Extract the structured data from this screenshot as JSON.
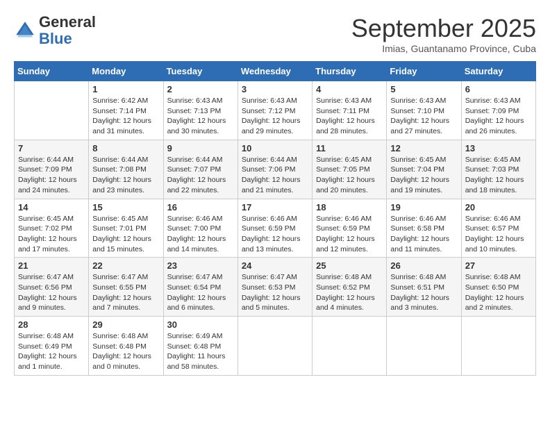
{
  "logo": {
    "general": "General",
    "blue": "Blue"
  },
  "header": {
    "month": "September 2025",
    "location": "Imias, Guantanamo Province, Cuba"
  },
  "days_of_week": [
    "Sunday",
    "Monday",
    "Tuesday",
    "Wednesday",
    "Thursday",
    "Friday",
    "Saturday"
  ],
  "weeks": [
    [
      {
        "day": "",
        "info": ""
      },
      {
        "day": "1",
        "info": "Sunrise: 6:42 AM\nSunset: 7:14 PM\nDaylight: 12 hours\nand 31 minutes."
      },
      {
        "day": "2",
        "info": "Sunrise: 6:43 AM\nSunset: 7:13 PM\nDaylight: 12 hours\nand 30 minutes."
      },
      {
        "day": "3",
        "info": "Sunrise: 6:43 AM\nSunset: 7:12 PM\nDaylight: 12 hours\nand 29 minutes."
      },
      {
        "day": "4",
        "info": "Sunrise: 6:43 AM\nSunset: 7:11 PM\nDaylight: 12 hours\nand 28 minutes."
      },
      {
        "day": "5",
        "info": "Sunrise: 6:43 AM\nSunset: 7:10 PM\nDaylight: 12 hours\nand 27 minutes."
      },
      {
        "day": "6",
        "info": "Sunrise: 6:43 AM\nSunset: 7:09 PM\nDaylight: 12 hours\nand 26 minutes."
      }
    ],
    [
      {
        "day": "7",
        "info": "Sunrise: 6:44 AM\nSunset: 7:09 PM\nDaylight: 12 hours\nand 24 minutes."
      },
      {
        "day": "8",
        "info": "Sunrise: 6:44 AM\nSunset: 7:08 PM\nDaylight: 12 hours\nand 23 minutes."
      },
      {
        "day": "9",
        "info": "Sunrise: 6:44 AM\nSunset: 7:07 PM\nDaylight: 12 hours\nand 22 minutes."
      },
      {
        "day": "10",
        "info": "Sunrise: 6:44 AM\nSunset: 7:06 PM\nDaylight: 12 hours\nand 21 minutes."
      },
      {
        "day": "11",
        "info": "Sunrise: 6:45 AM\nSunset: 7:05 PM\nDaylight: 12 hours\nand 20 minutes."
      },
      {
        "day": "12",
        "info": "Sunrise: 6:45 AM\nSunset: 7:04 PM\nDaylight: 12 hours\nand 19 minutes."
      },
      {
        "day": "13",
        "info": "Sunrise: 6:45 AM\nSunset: 7:03 PM\nDaylight: 12 hours\nand 18 minutes."
      }
    ],
    [
      {
        "day": "14",
        "info": "Sunrise: 6:45 AM\nSunset: 7:02 PM\nDaylight: 12 hours\nand 17 minutes."
      },
      {
        "day": "15",
        "info": "Sunrise: 6:45 AM\nSunset: 7:01 PM\nDaylight: 12 hours\nand 15 minutes."
      },
      {
        "day": "16",
        "info": "Sunrise: 6:46 AM\nSunset: 7:00 PM\nDaylight: 12 hours\nand 14 minutes."
      },
      {
        "day": "17",
        "info": "Sunrise: 6:46 AM\nSunset: 6:59 PM\nDaylight: 12 hours\nand 13 minutes."
      },
      {
        "day": "18",
        "info": "Sunrise: 6:46 AM\nSunset: 6:59 PM\nDaylight: 12 hours\nand 12 minutes."
      },
      {
        "day": "19",
        "info": "Sunrise: 6:46 AM\nSunset: 6:58 PM\nDaylight: 12 hours\nand 11 minutes."
      },
      {
        "day": "20",
        "info": "Sunrise: 6:46 AM\nSunset: 6:57 PM\nDaylight: 12 hours\nand 10 minutes."
      }
    ],
    [
      {
        "day": "21",
        "info": "Sunrise: 6:47 AM\nSunset: 6:56 PM\nDaylight: 12 hours\nand 9 minutes."
      },
      {
        "day": "22",
        "info": "Sunrise: 6:47 AM\nSunset: 6:55 PM\nDaylight: 12 hours\nand 7 minutes."
      },
      {
        "day": "23",
        "info": "Sunrise: 6:47 AM\nSunset: 6:54 PM\nDaylight: 12 hours\nand 6 minutes."
      },
      {
        "day": "24",
        "info": "Sunrise: 6:47 AM\nSunset: 6:53 PM\nDaylight: 12 hours\nand 5 minutes."
      },
      {
        "day": "25",
        "info": "Sunrise: 6:48 AM\nSunset: 6:52 PM\nDaylight: 12 hours\nand 4 minutes."
      },
      {
        "day": "26",
        "info": "Sunrise: 6:48 AM\nSunset: 6:51 PM\nDaylight: 12 hours\nand 3 minutes."
      },
      {
        "day": "27",
        "info": "Sunrise: 6:48 AM\nSunset: 6:50 PM\nDaylight: 12 hours\nand 2 minutes."
      }
    ],
    [
      {
        "day": "28",
        "info": "Sunrise: 6:48 AM\nSunset: 6:49 PM\nDaylight: 12 hours\nand 1 minute."
      },
      {
        "day": "29",
        "info": "Sunrise: 6:48 AM\nSunset: 6:48 PM\nDaylight: 12 hours\nand 0 minutes."
      },
      {
        "day": "30",
        "info": "Sunrise: 6:49 AM\nSunset: 6:48 PM\nDaylight: 11 hours\nand 58 minutes."
      },
      {
        "day": "",
        "info": ""
      },
      {
        "day": "",
        "info": ""
      },
      {
        "day": "",
        "info": ""
      },
      {
        "day": "",
        "info": ""
      }
    ]
  ]
}
